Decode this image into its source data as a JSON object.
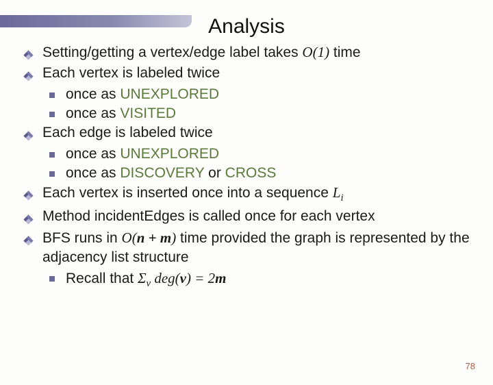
{
  "title": "Analysis",
  "items": [
    {
      "pre": "Setting/getting a vertex/edge label takes ",
      "math": "O",
      "mathargs": "(1)",
      "post": " time"
    },
    {
      "text": "Each vertex is labeled twice"
    },
    {
      "sub": true,
      "pre": "once as ",
      "green": "UNEXPLORED"
    },
    {
      "sub": true,
      "pre": "once as ",
      "green": "VISITED"
    },
    {
      "text": "Each edge is labeled twice"
    },
    {
      "sub": true,
      "pre": "once as ",
      "green": "UNEXPLORED"
    },
    {
      "sub": true,
      "pre": "once as ",
      "green": "DISCOVERY",
      "mid": " or ",
      "green2": "CROSS"
    },
    {
      "pre": "Each vertex is inserted once into a sequence ",
      "mathvar": "L",
      "subscript": "i"
    },
    {
      "text": "Method incidentEdges is called once for each vertex"
    },
    {
      "pre": "BFS runs in ",
      "math": "O",
      "mathargs2": "n + m",
      "post": " time provided the graph is represented by the adjacency list structure",
      "wrap": true
    },
    {
      "sub": true,
      "recall": true
    }
  ],
  "recall": {
    "pre": "Recall that ",
    "sigma": "Σ",
    "sigmasub": "v",
    "deg": " deg(",
    "v": "v",
    "close": ") = 2",
    "m": "m"
  },
  "page": "78"
}
